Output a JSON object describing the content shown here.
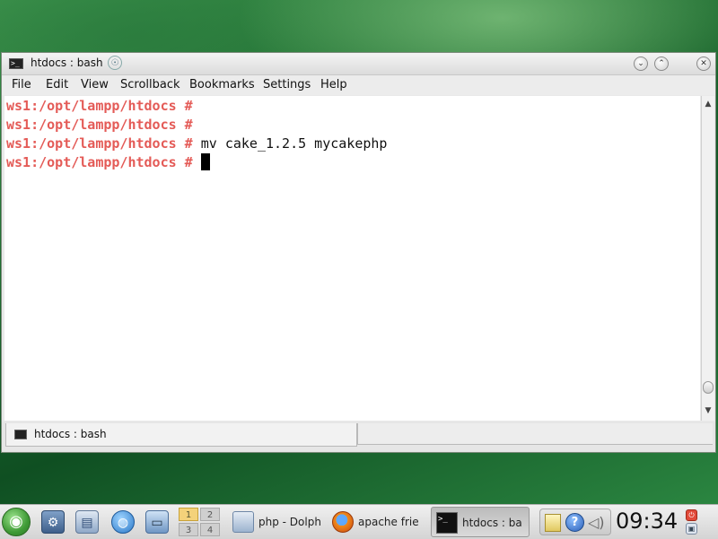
{
  "window": {
    "title": "htdocs : bash",
    "pin_glyph": "☉",
    "buttons": {
      "minimize": "⌄",
      "maximize": "⌃",
      "close": "✕"
    }
  },
  "menu": [
    "File",
    "Edit",
    "View",
    "Scrollback",
    "Bookmarks",
    "Settings",
    "Help"
  ],
  "terminal": {
    "lines": [
      {
        "prompt": "ws1:/opt/lampp/htdocs #",
        "command": ""
      },
      {
        "prompt": "ws1:/opt/lampp/htdocs #",
        "command": ""
      },
      {
        "prompt": "ws1:/opt/lampp/htdocs #",
        "command": "mv cake_1.2.5 mycakephp"
      },
      {
        "prompt": "ws1:/opt/lampp/htdocs #",
        "command": ""
      }
    ],
    "colors": {
      "prompt": "#e45b57",
      "text": "#111111",
      "background": "#ffffff"
    }
  },
  "tab": {
    "label": "htdocs : bash"
  },
  "taskbar": {
    "pager": [
      "1",
      "2",
      "3",
      "4"
    ],
    "active_desktop": "1",
    "tasks": [
      {
        "label": "php - Dolph",
        "icon": "dolphin-folder-icon"
      },
      {
        "label": "apache frie",
        "icon": "firefox-icon"
      },
      {
        "label": "htdocs : ba",
        "icon": "terminal-icon",
        "active": true
      }
    ],
    "clock": "09:34"
  }
}
